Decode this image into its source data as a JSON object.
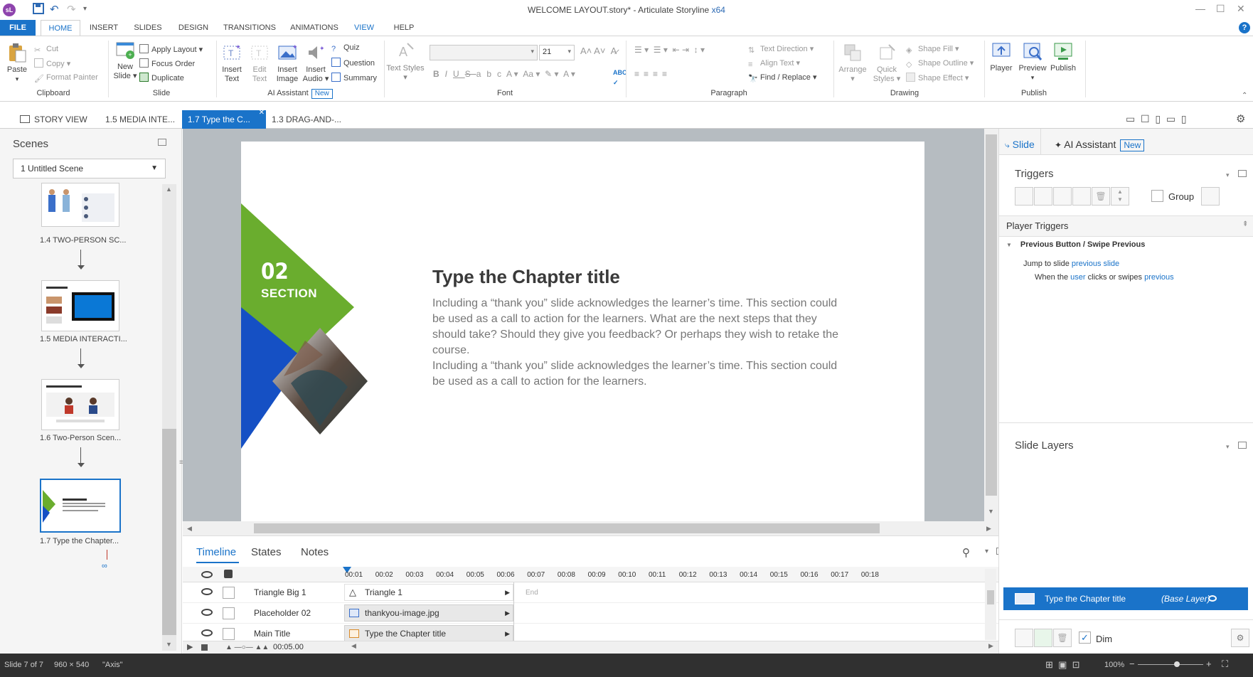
{
  "window": {
    "title": "WELCOME LAYOUT.story* - Articulate Storyline",
    "arch": "x64",
    "app_logo": "sL"
  },
  "ribbon_tabs": [
    "FILE",
    "HOME",
    "INSERT",
    "SLIDES",
    "DESIGN",
    "TRANSITIONS",
    "ANIMATIONS",
    "VIEW",
    "HELP"
  ],
  "ribbon": {
    "clipboard": {
      "label": "Clipboard",
      "paste": "Paste",
      "cut": "Cut",
      "copy": "Copy",
      "format_painter": "Format Painter"
    },
    "slide": {
      "label": "Slide",
      "new_slide": "New Slide",
      "apply_layout": "Apply Layout",
      "focus_order": "Focus Order",
      "duplicate": "Duplicate"
    },
    "ai": {
      "label": "AI Assistant",
      "badge": "New",
      "insert_text": "Insert Text",
      "edit_text": "Edit Text",
      "insert_image": "Insert Image",
      "insert_audio": "Insert Audio",
      "quiz": "Quiz",
      "question": "Question",
      "summary": "Summary"
    },
    "font": {
      "label": "Font",
      "text_styles": "Text Styles",
      "font_size": "21"
    },
    "paragraph": {
      "label": "Paragraph",
      "text_direction": "Text Direction",
      "align_text": "Align Text",
      "find_replace": "Find / Replace"
    },
    "drawing": {
      "label": "Drawing",
      "arrange": "Arrange",
      "quick_styles": "Quick Styles",
      "shape_fill": "Shape Fill",
      "shape_outline": "Shape Outline",
      "shape_effect": "Shape Effect"
    },
    "publish": {
      "label": "Publish",
      "player": "Player",
      "preview": "Preview",
      "publish": "Publish"
    }
  },
  "doc_tabs": [
    "STORY VIEW",
    "1.5 MEDIA INTE...",
    "1.7 Type the C...",
    "1.3 DRAG-AND-..."
  ],
  "scenes": {
    "title": "Scenes",
    "selected": "1 Untitled Scene",
    "slides": [
      "1.4 TWO-PERSON SC...",
      "1.5 MEDIA INTERACTI...",
      "1.6 Two-Person Scen...",
      "1.7 Type the Chapter..."
    ]
  },
  "slide": {
    "number": "02",
    "section": "SECTION",
    "title": "Type the Chapter title",
    "body1": "Including a “thank you” slide acknowledges the learner’s time. This section could be used as a call to action for the learners. What are the next steps that they should take? Should they give you feedback? Or perhaps they wish to retake the course.",
    "body2": "Including a “thank you” slide acknowledges the learner’s time. This section could be used as a call to action for the learners.",
    "colors": {
      "green": "#6aad2e",
      "blue": "#1550c4",
      "title": "#3a3a3a",
      "body": "#777777"
    }
  },
  "timeline": {
    "tabs": [
      "Timeline",
      "States",
      "Notes"
    ],
    "ticks": [
      "00:01",
      "00:02",
      "00:03",
      "00:04",
      "00:05",
      "00:06",
      "00:07",
      "00:08",
      "00:09",
      "00:10",
      "00:11",
      "00:12",
      "00:13",
      "00:14",
      "00:15",
      "00:16",
      "00:17",
      "00:18"
    ],
    "end_label": "End",
    "rows": [
      {
        "name": "Triangle Big 1",
        "bar": "Triangle 1"
      },
      {
        "name": "Placeholder 02",
        "bar": "thankyou-image.jpg"
      },
      {
        "name": "Main Title",
        "bar": "Type the Chapter title"
      }
    ],
    "duration": "00:05.00"
  },
  "right_panel": {
    "tabs": {
      "slide": "Slide",
      "ai": "AI Assistant",
      "badge": "New"
    },
    "triggers_title": "Triggers",
    "group_label": "Group",
    "player_triggers": "Player Triggers",
    "trigger_name": "Previous Button / Swipe Previous",
    "action_text": "Jump to slide",
    "action_target": "previous slide",
    "when_text1": "When the",
    "when_user": "user",
    "when_text2": "clicks or swipes",
    "when_target": "previous",
    "layers_title": "Slide Layers",
    "base_layer_name": "Type the Chapter title",
    "base_layer_tag": "(Base Layer)",
    "dim_label": "Dim"
  },
  "status": {
    "slide_of": "Slide 7 of 7",
    "size": "960 × 540",
    "theme": "\"Axis\"",
    "zoom": "100%"
  }
}
